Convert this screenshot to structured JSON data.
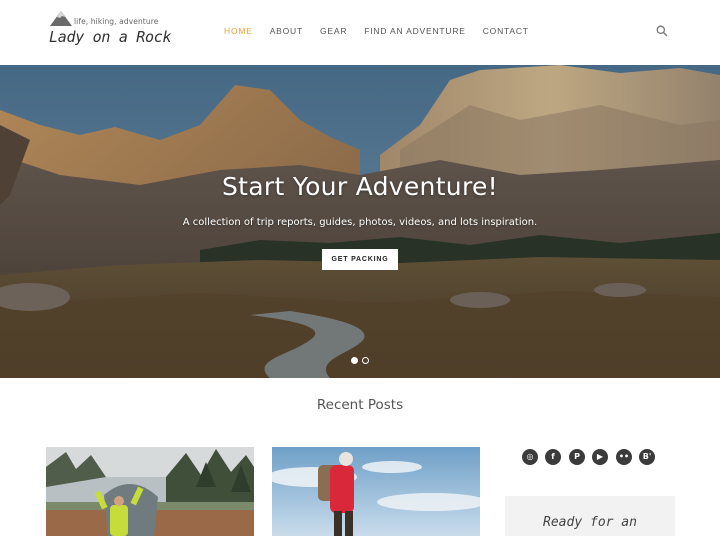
{
  "brand": {
    "tagline": "life, hiking, adventure",
    "name": "Lady on a Rock"
  },
  "nav": {
    "items": [
      {
        "label": "HOME",
        "active": true
      },
      {
        "label": "ABOUT",
        "active": false
      },
      {
        "label": "GEAR",
        "active": false
      },
      {
        "label": "FIND AN ADVENTURE",
        "active": false
      },
      {
        "label": "CONTACT",
        "active": false
      }
    ],
    "search_icon": "search-icon"
  },
  "hero": {
    "title": "Start Your Adventure!",
    "subtitle": "A collection of trip reports, guides, photos, videos, and lots inspiration.",
    "button_label": "GET PACKING",
    "slides": {
      "count": 2,
      "active_index": 0
    }
  },
  "recent_posts": {
    "heading": "Recent Posts"
  },
  "sidebar": {
    "social": [
      {
        "icon": "instagram-icon",
        "glyph": "◎"
      },
      {
        "icon": "facebook-icon",
        "glyph": "f"
      },
      {
        "icon": "pinterest-icon",
        "glyph": "P"
      },
      {
        "icon": "youtube-icon",
        "glyph": "▶"
      },
      {
        "icon": "flickr-icon",
        "glyph": "••"
      },
      {
        "icon": "bloglovin-icon",
        "glyph": "B'"
      }
    ],
    "widget_text": "Ready for an"
  },
  "colors": {
    "accent": "#e7a23b",
    "social_bg": "#3b3b3b",
    "widget_bg": "#f2f2f2"
  }
}
